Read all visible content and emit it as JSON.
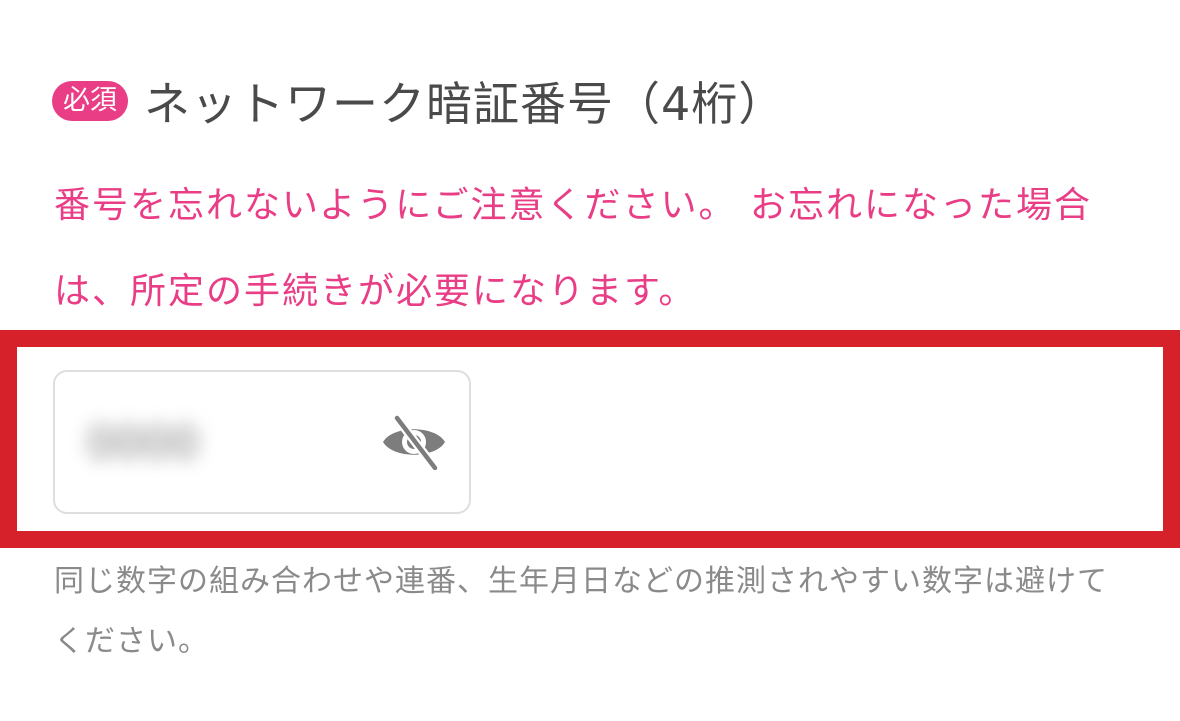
{
  "field": {
    "required_badge": "必須",
    "title": "ネットワーク暗証番号（4桁）",
    "notice": "番号を忘れないようにご注意ください。 お忘れになった場合は、所定の手続きが必要になります。",
    "hint": "同じ数字の組み合わせや連番、生年月日などの推測されやすい数字は避けてください。"
  },
  "pin_input": {
    "value": "0000",
    "visibility_icon": "eye-slash-icon"
  },
  "colors": {
    "accent_pink": "#e93d86",
    "highlight_red": "#d6202a",
    "title_text": "#4a4a4a",
    "hint_text": "#8a8a8a",
    "icon_gray": "#7d7d7d"
  }
}
